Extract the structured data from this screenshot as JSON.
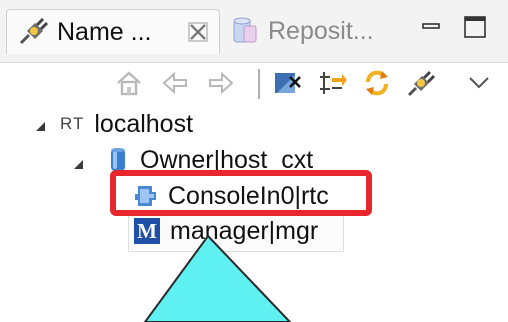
{
  "tabs": [
    {
      "label": "Name ...",
      "icon": "plug-icon",
      "active": true
    },
    {
      "label": "Reposit...",
      "icon": "repository-icon",
      "active": false
    }
  ],
  "window_buttons": [
    "minimize-icon",
    "maximize-icon"
  ],
  "toolbar": {
    "icons": [
      "home-icon",
      "back-arrow-icon",
      "forward-arrow-icon",
      "connect-icon",
      "expand-icon",
      "refresh-icon",
      "plug-icon",
      "view-menu-icon"
    ]
  },
  "tree": {
    "root": {
      "prefix": "RT",
      "label": "localhost"
    },
    "owner": {
      "label": "Owner|host_cxt"
    },
    "console": {
      "label": "ConsoleIn0|rtc"
    },
    "manager": {
      "badge": "M",
      "label": "manager|mgr"
    }
  },
  "colors": {
    "highlight": "#e8272c",
    "triangle": "#5ff1f2",
    "tree_icon_blue": "#3a7fd0"
  }
}
